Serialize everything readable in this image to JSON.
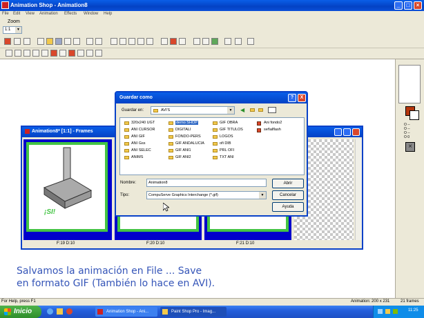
{
  "app": {
    "title": "Animation Shop - Animation8",
    "menu": [
      "File",
      "Edit",
      "View",
      "Animation",
      "Effects",
      "Window",
      "Help"
    ],
    "zoom_label": "Zoom",
    "zoom_value": "1:1"
  },
  "frames_window": {
    "title": "Animation8* [1:1] - Frames",
    "frames": [
      {
        "label": "F:19  D:10",
        "text": "¡SI!"
      },
      {
        "label": "F:20  D:10"
      },
      {
        "label": "F:21  D:10"
      }
    ]
  },
  "dialog": {
    "title": "Guardar como",
    "save_in_label": "Guardar en:",
    "save_in_value": "AVI'S",
    "help_glyph": "?",
    "close_glyph": "X",
    "files": [
      {
        "name": "320x240 UGT",
        "kind": "folder"
      },
      {
        "name": "ANI CURSOR",
        "kind": "folder"
      },
      {
        "name": "ANI GIF",
        "kind": "folder"
      },
      {
        "name": "ANI Gss",
        "kind": "folder"
      },
      {
        "name": "ANI SELEC",
        "kind": "folder"
      },
      {
        "name": "ANIMS",
        "kind": "folder"
      },
      {
        "name": "demo SHOP",
        "kind": "folder",
        "selected": true
      },
      {
        "name": "DIGITALI",
        "kind": "folder"
      },
      {
        "name": "FONDO-PERS",
        "kind": "folder"
      },
      {
        "name": "GIF ANDALUCIA",
        "kind": "folder"
      },
      {
        "name": "GIF ANI1",
        "kind": "folder"
      },
      {
        "name": "GIF ANI2",
        "kind": "folder"
      },
      {
        "name": "GIF OBRA",
        "kind": "folder"
      },
      {
        "name": "GIF TITULOS",
        "kind": "folder"
      },
      {
        "name": "LOGOS",
        "kind": "folder"
      },
      {
        "name": "ofi DIB",
        "kind": "folder"
      },
      {
        "name": "PRL OFI",
        "kind": "folder"
      },
      {
        "name": "TXT ANI",
        "kind": "folder"
      },
      {
        "name": "Ani fondo2",
        "kind": "file"
      },
      {
        "name": "señalflash",
        "kind": "file"
      }
    ],
    "name_label": "Nombre:",
    "name_value": "Animation8",
    "type_label": "Tipo:",
    "type_value": "CompuServe Graphics Interchange (*.gif)",
    "open_button": "Abrir",
    "cancel_button": "Cancelar",
    "help_button": "Ayuda"
  },
  "caption": {
    "line1": "Salvamos la animación en File ... Save",
    "line2": "en formato GIF (También lo hace en AVI)."
  },
  "status": {
    "left": "For Help, press F1",
    "animation": "Animation: 200 x 231",
    "frames": "21 frames"
  },
  "taskbar": {
    "start": "Inicio",
    "task1": "Animation Shop - Ani...",
    "task2": "Paint Shop Pro - Imag...",
    "clock": "11:25"
  },
  "palette": {
    "fg_color": "#b5360e",
    "bg_color": "#ffffff",
    "rows": [
      "O --",
      "O --",
      "O --",
      "O 0"
    ]
  },
  "colors": {
    "title_blue": "#0a4fd9",
    "xp_green": "#3a9a34",
    "frame_green": "#44c444",
    "frame_blue": "#0000cc",
    "caption_blue": "#3555b8"
  }
}
